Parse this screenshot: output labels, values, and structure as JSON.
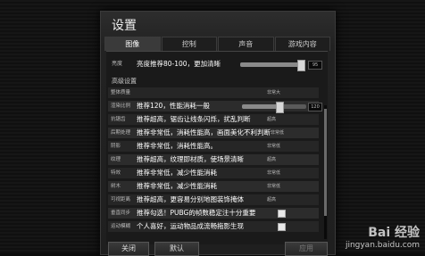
{
  "dialog": {
    "title": "设置"
  },
  "tabs": [
    {
      "label": "图像",
      "active": true
    },
    {
      "label": "控制",
      "active": false
    },
    {
      "label": "声音",
      "active": false
    },
    {
      "label": "游戏内容",
      "active": false
    }
  ],
  "brightness": {
    "label": "亮度",
    "note": "亮度推荐80-100，更加清晰",
    "level_percent": 95,
    "value": "95"
  },
  "advanced": {
    "title": "高级设置"
  },
  "rows": [
    {
      "label": "整体质量",
      "text": "",
      "value": "非常大"
    },
    {
      "label": "渲染比例",
      "text": "推荐120，性能消耗一般",
      "value": "120"
    },
    {
      "label": "抗锯齿",
      "text": "推荐超高，锯齿让线条闪烁，扰乱判断",
      "value": "超高"
    },
    {
      "label": "后期处理",
      "text": "推荐非常低，消耗性能高，画面美化不利判断",
      "value": "非常低"
    },
    {
      "label": "阴影",
      "text": "推荐非常低，消耗性能高。",
      "value": "非常低"
    },
    {
      "label": "纹理",
      "text": "推荐超高，纹理即材质，使场景清晰",
      "value": "超高"
    },
    {
      "label": "特效",
      "text": "推荐非常低，减少性能消耗",
      "value": "非常低"
    },
    {
      "label": "树木",
      "text": "推荐非常低，减少性能消耗",
      "value": "非常低"
    },
    {
      "label": "可视距离",
      "text": "推荐超高，更容易分别地图装饰掩体",
      "value": "超高"
    },
    {
      "label": "垂直同步",
      "text": "推荐勾选！PUBG的帧数稳定注十分重要",
      "checked": true
    },
    {
      "label": "运动模糊",
      "text": "个人喜好，运动物品成流畅拖影生现",
      "checked": true
    }
  ],
  "buttons": {
    "close": "关闭",
    "default": "默认",
    "apply": "应用"
  },
  "watermark": {
    "brand": "Bai 经验",
    "url": "jingyan.baidu.com"
  }
}
